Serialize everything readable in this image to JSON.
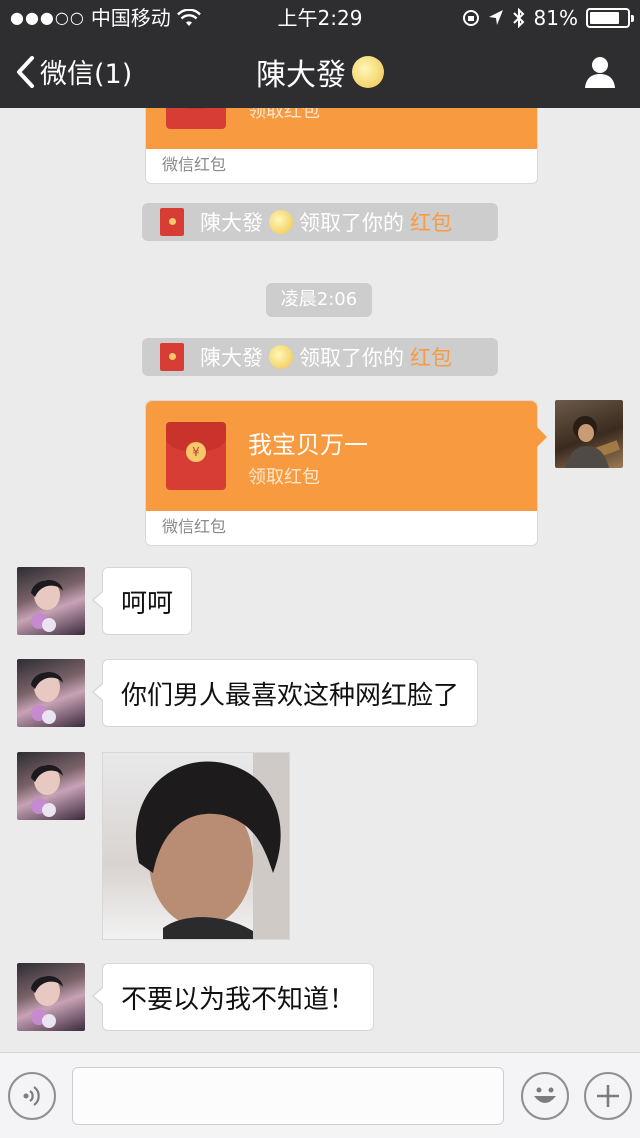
{
  "status_bar": {
    "signal_dots": "●●●○○",
    "carrier": "中国移动",
    "time": "上午2:29",
    "battery": "81%",
    "battery_level": 0.81
  },
  "nav": {
    "back_label": "微信(1)",
    "title": "陳大發",
    "icons": {
      "back": "chevron-left-icon",
      "title_emoji": "moon-face-emoji",
      "profile": "person-icon"
    }
  },
  "messages": {
    "card_top": {
      "sub": "领取红包",
      "footer": "微信红包"
    },
    "sys1": {
      "name": "陳大發",
      "text": "领取了你的",
      "link": "红包"
    },
    "timestamp": "凌晨2:06",
    "sys2": {
      "name": "陳大發",
      "text": "领取了你的",
      "link": "红包"
    },
    "card_me": {
      "title": "我宝贝万一",
      "sub": "领取红包",
      "footer": "微信红包"
    },
    "msg1": "呵呵",
    "msg2": "你们男人最喜欢这种网红脸了",
    "msg4": "不要以为我不知道！"
  },
  "colors": {
    "accent": "#f89b40",
    "topbar": "#2e2e31",
    "background": "#ebebeb"
  }
}
